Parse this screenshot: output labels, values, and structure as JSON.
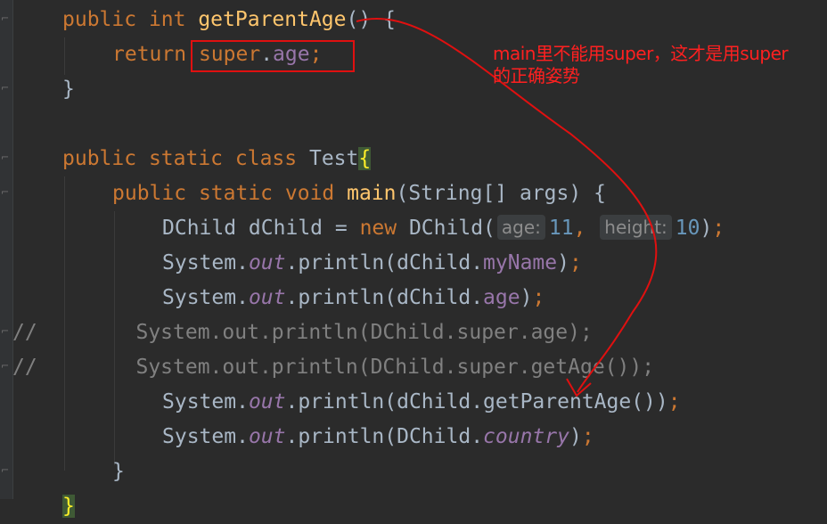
{
  "editor": {
    "lines": [
      {
        "id": "l1",
        "tokens": [
          [
            "kw",
            "public "
          ],
          [
            "kw",
            "int "
          ],
          [
            "fn",
            "getParentAge"
          ],
          [
            "plain",
            "() {"
          ]
        ]
      },
      {
        "id": "l2",
        "tokens": [
          [
            "kw",
            "return "
          ],
          [
            "kw",
            "super"
          ],
          [
            "plain",
            "."
          ],
          [
            "fld",
            "age"
          ],
          [
            "kw",
            ";"
          ]
        ]
      },
      {
        "id": "l3",
        "tokens": [
          [
            "plain",
            "}"
          ]
        ]
      },
      {
        "id": "l4",
        "tokens": []
      },
      {
        "id": "l5",
        "tokens": [
          [
            "kw",
            "public "
          ],
          [
            "kw",
            "static "
          ],
          [
            "kw",
            "class "
          ],
          [
            "plain",
            "Test"
          ],
          [
            "brace",
            "{"
          ]
        ]
      },
      {
        "id": "l6",
        "tokens": [
          [
            "kw",
            "public "
          ],
          [
            "kw",
            "static "
          ],
          [
            "kw",
            "void "
          ],
          [
            "fn",
            "main"
          ],
          [
            "plain",
            "(String[] args) {"
          ]
        ]
      },
      {
        "id": "l7",
        "tokens": [
          [
            "plain",
            "DChild dChild = "
          ],
          [
            "kw",
            "new "
          ],
          [
            "plain",
            "DChild("
          ],
          [
            "hint",
            "age:"
          ],
          [
            "num",
            "11"
          ],
          [
            "kw",
            ", "
          ],
          [
            "hint",
            "height:"
          ],
          [
            "num",
            "10"
          ],
          [
            "plain",
            ")"
          ],
          [
            "kw",
            ";"
          ]
        ]
      },
      {
        "id": "l8",
        "tokens": [
          [
            "plain",
            "System."
          ],
          [
            "sfld",
            "out"
          ],
          [
            "plain",
            ".println(dChild."
          ],
          [
            "fld",
            "myName"
          ],
          [
            "plain",
            ")"
          ],
          [
            "kw",
            ";"
          ]
        ]
      },
      {
        "id": "l9",
        "tokens": [
          [
            "plain",
            "System."
          ],
          [
            "sfld",
            "out"
          ],
          [
            "plain",
            ".println(dChild."
          ],
          [
            "fld",
            "age"
          ],
          [
            "plain",
            ")"
          ],
          [
            "kw",
            ";"
          ]
        ]
      },
      {
        "id": "l10",
        "tokens": [
          [
            "cmt",
            "//        System.out.println(DChild.super.age);"
          ]
        ]
      },
      {
        "id": "l11",
        "tokens": [
          [
            "cmt",
            "//        System.out.println(DChild.super.getAge());"
          ]
        ]
      },
      {
        "id": "l12",
        "tokens": [
          [
            "plain",
            "System."
          ],
          [
            "sfld",
            "out"
          ],
          [
            "plain",
            ".println(dChild.getParentAge())"
          ],
          [
            "kw",
            ";"
          ]
        ]
      },
      {
        "id": "l13",
        "tokens": [
          [
            "plain",
            "System."
          ],
          [
            "sfld",
            "out"
          ],
          [
            "plain",
            ".println(DChild."
          ],
          [
            "sfld",
            "country"
          ],
          [
            "plain",
            ")"
          ],
          [
            "kw",
            ";"
          ]
        ]
      },
      {
        "id": "l14",
        "tokens": [
          [
            "plain",
            "}"
          ]
        ]
      },
      {
        "id": "l15",
        "tokens": [
          [
            "brace",
            "}"
          ]
        ]
      }
    ]
  },
  "annotation": {
    "line1": "main里不能用super，这才是用super",
    "line2": "的正确姿势",
    "color": "#ff2020"
  },
  "colors": {
    "background": "#2b2b2b",
    "keyword": "#cc7832",
    "function": "#ffc66d",
    "field": "#9876aa",
    "number": "#6897bb",
    "comment": "#808080",
    "text": "#a9b7c6",
    "annotation_red": "#e01010"
  }
}
